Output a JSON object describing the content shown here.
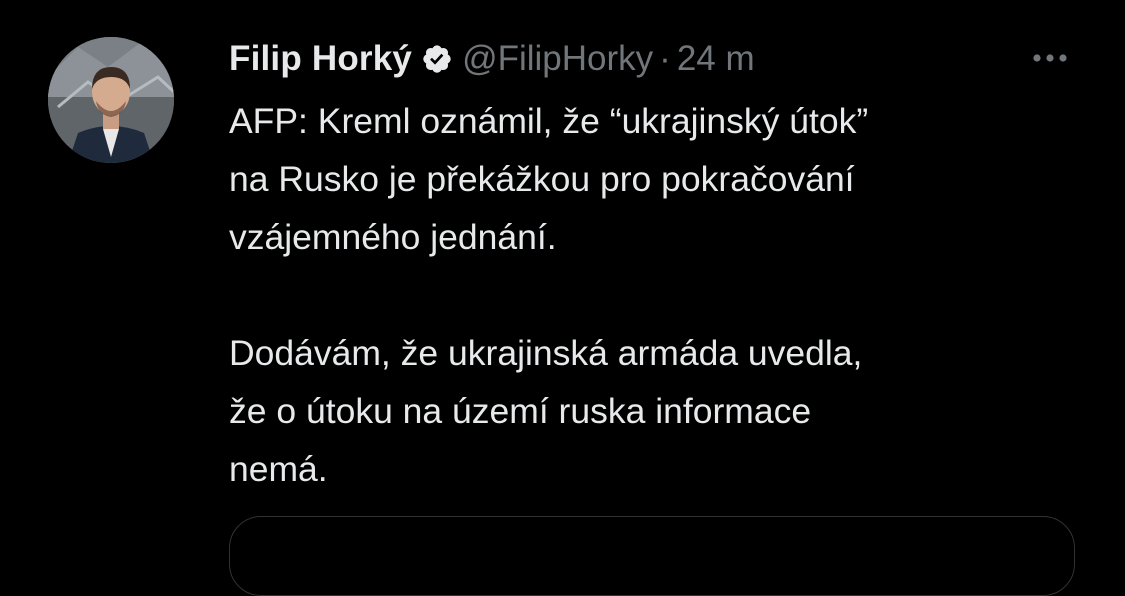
{
  "tweet": {
    "author_name": "Filip Horký",
    "handle": "@FilipHorky",
    "separator": "·",
    "time": "24 m",
    "text_lines": [
      "AFP: Kreml oznámil, že “ukrajinský útok”",
      "na Rusko je překážkou pro pokračování",
      "vzájemného jednání.",
      "Dodávám, že ukrajinská armáda uvedla,",
      "že o útoku na území ruska informace",
      "nemá."
    ]
  },
  "icons": {
    "verified": "verified-badge-icon",
    "more": "more-options-icon"
  },
  "colors": {
    "background": "#000000",
    "primary_text": "#e7e9ea",
    "secondary_text": "#71767b",
    "border": "#2f3336"
  }
}
